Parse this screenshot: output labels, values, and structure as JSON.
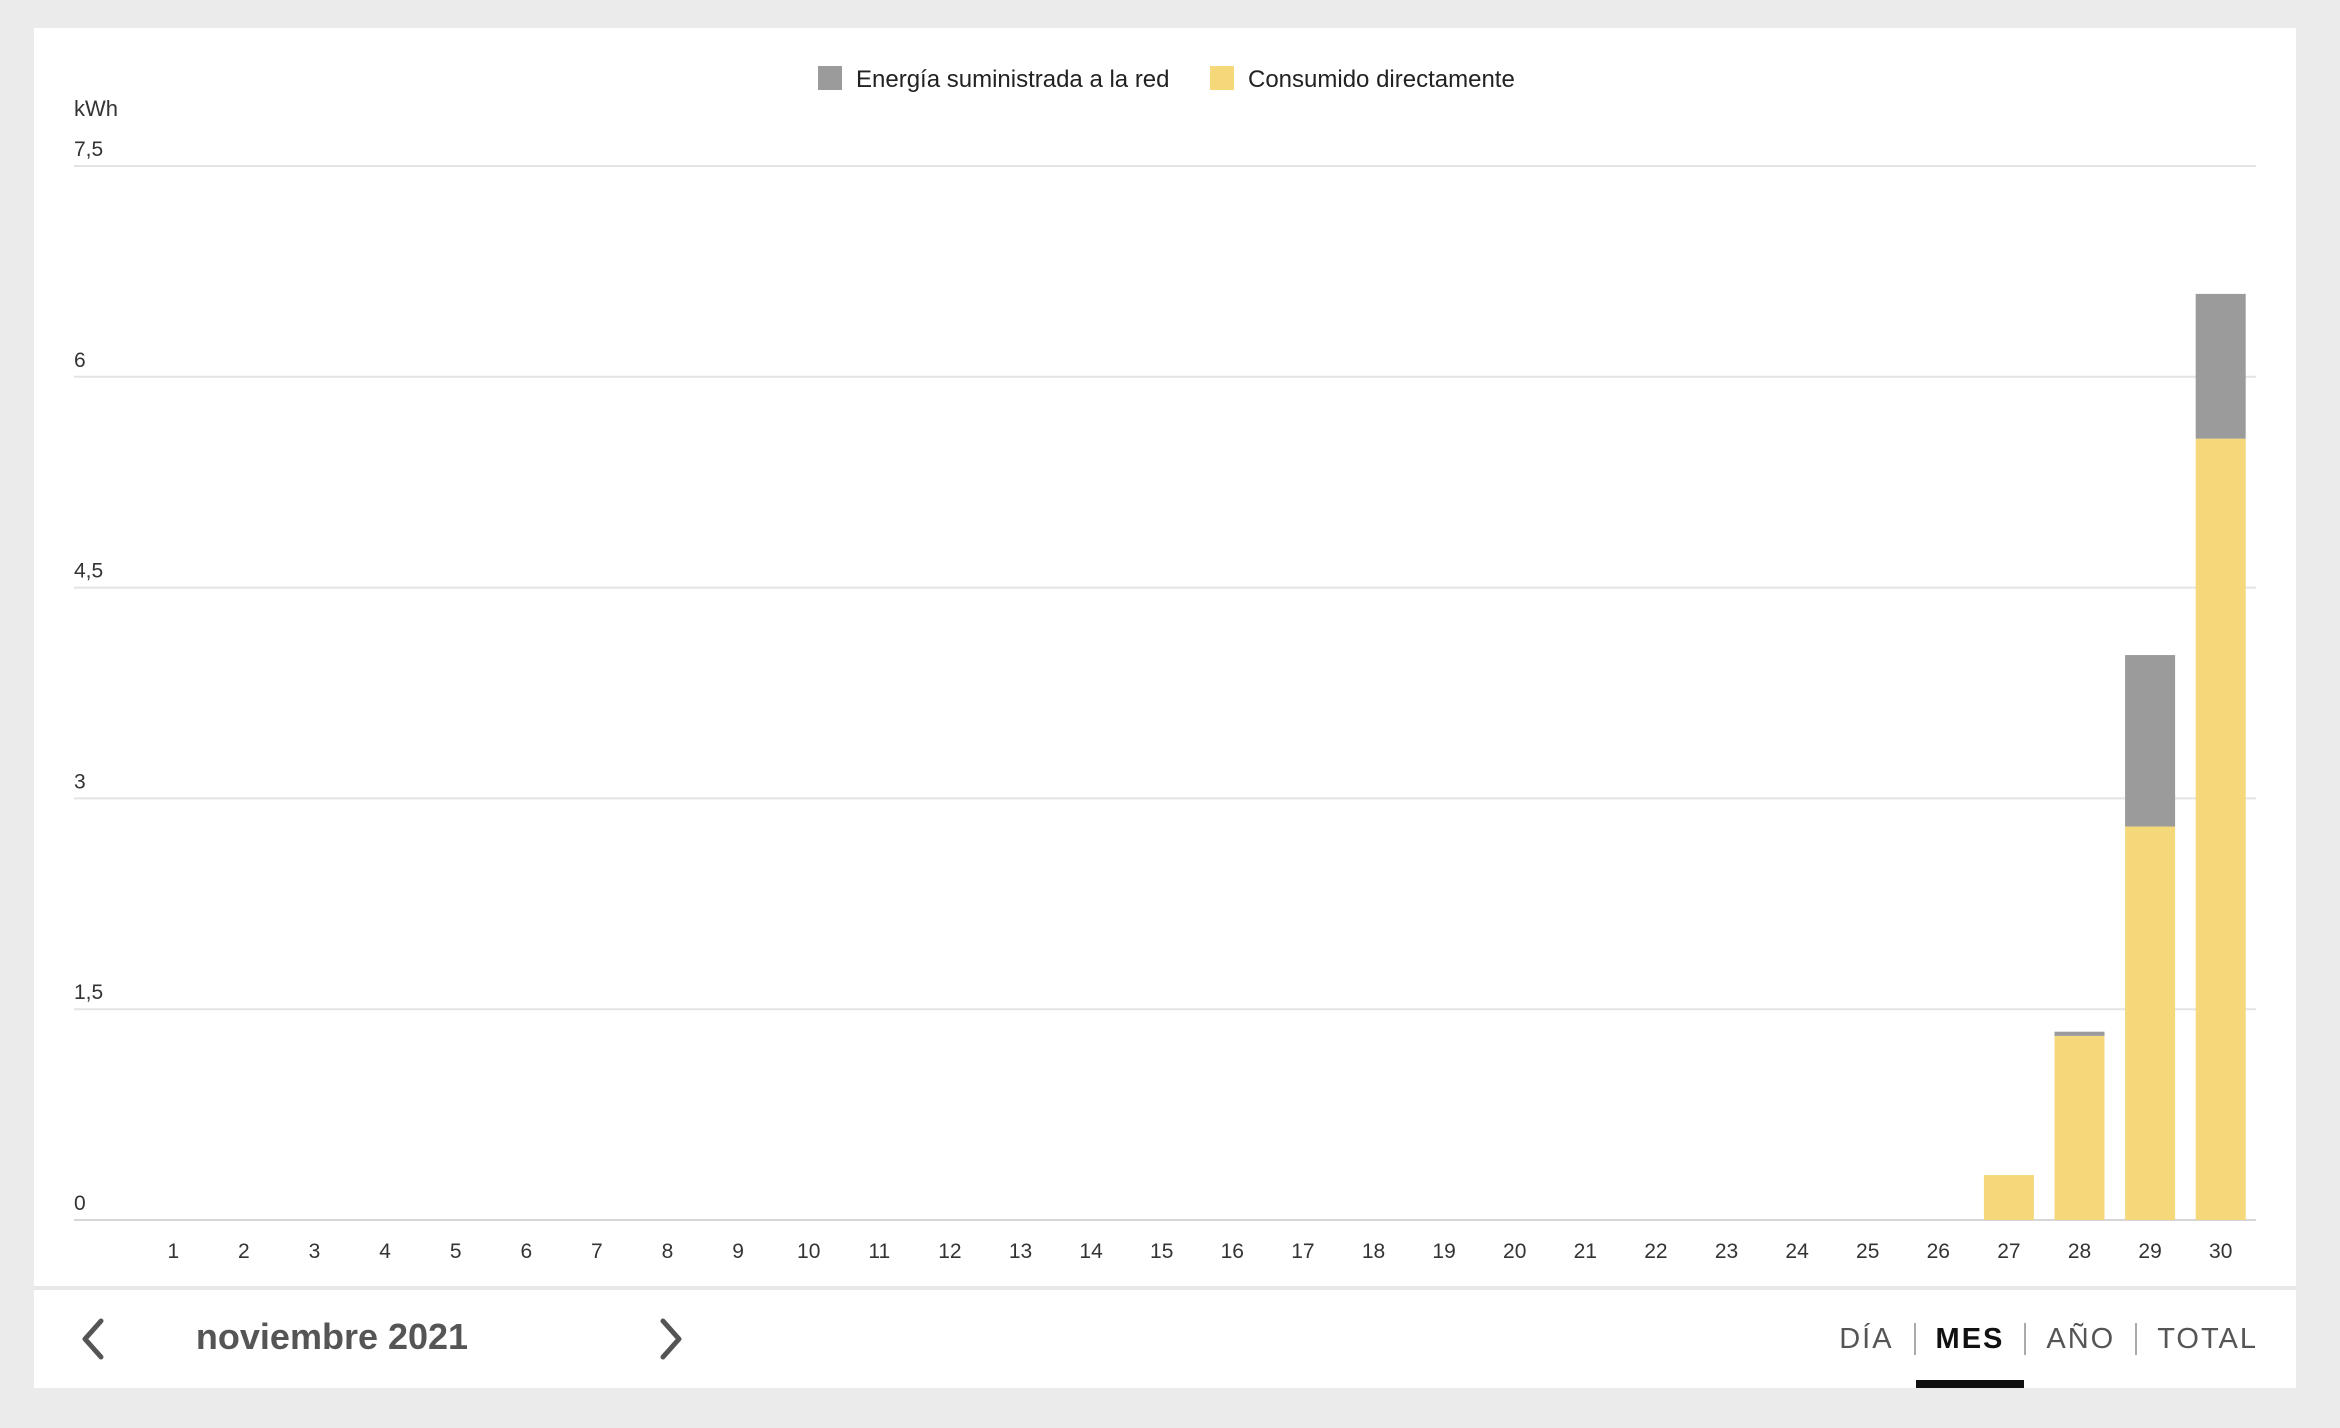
{
  "colors": {
    "grid_supplied": "#9b9b9b",
    "direct_consumption": "#f5d87a",
    "background": "#eaebea"
  },
  "navigation": {
    "period_label": "noviembre 2021",
    "prev_icon": "chevron-left-icon",
    "next_icon": "chevron-right-icon",
    "tabs": [
      {
        "label": "DÍA",
        "active": false
      },
      {
        "label": "MES",
        "active": true
      },
      {
        "label": "AÑO",
        "active": false
      },
      {
        "label": "TOTAL",
        "active": false
      }
    ]
  },
  "chart_data": {
    "type": "bar",
    "stacked": true,
    "ylabel": "kWh",
    "ylim": [
      0,
      7.5
    ],
    "y_ticks": [
      "0",
      "1,5",
      "3",
      "4,5",
      "6",
      "7,5"
    ],
    "y_tick_values": [
      0,
      1.5,
      3,
      4.5,
      6,
      7.5
    ],
    "grid": true,
    "legend_position": "top-center",
    "categories": [
      "1",
      "2",
      "3",
      "4",
      "5",
      "6",
      "7",
      "8",
      "9",
      "10",
      "11",
      "12",
      "13",
      "14",
      "15",
      "16",
      "17",
      "18",
      "19",
      "20",
      "21",
      "22",
      "23",
      "24",
      "25",
      "26",
      "27",
      "28",
      "29",
      "30"
    ],
    "series": [
      {
        "name": "Consumido directamente",
        "color": "#f5d87a",
        "values": [
          0,
          0,
          0,
          0,
          0,
          0,
          0,
          0,
          0,
          0,
          0,
          0,
          0,
          0,
          0,
          0,
          0,
          0,
          0,
          0,
          0,
          0,
          0,
          0,
          0,
          0,
          0.32,
          1.31,
          2.8,
          5.56
        ]
      },
      {
        "name": "Energía suministrada a la red",
        "color": "#9b9b9b",
        "values": [
          0,
          0,
          0,
          0,
          0,
          0,
          0,
          0,
          0,
          0,
          0,
          0,
          0,
          0,
          0,
          0,
          0,
          0,
          0,
          0,
          0,
          0,
          0,
          0,
          0,
          0,
          0,
          0.03,
          1.22,
          1.03
        ]
      }
    ]
  }
}
